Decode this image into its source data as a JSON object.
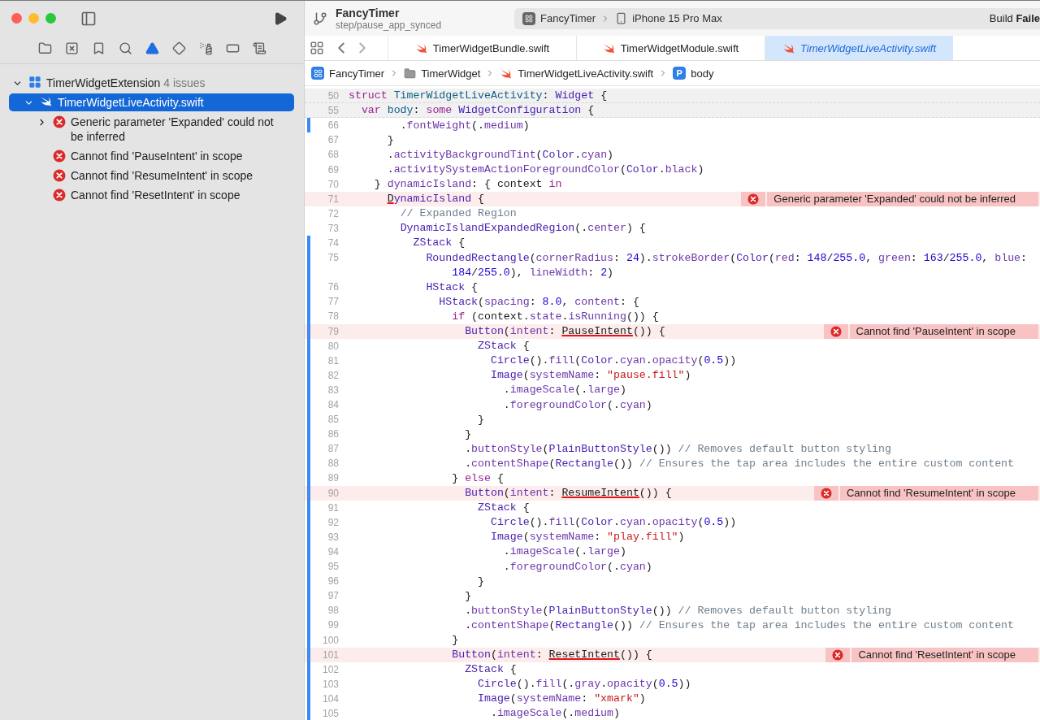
{
  "sidebar": {
    "navigator_tabs": [
      {
        "kind": "folder",
        "selected": false
      },
      {
        "kind": "source",
        "selected": false
      },
      {
        "kind": "bookmark",
        "selected": false
      },
      {
        "kind": "search",
        "selected": false
      },
      {
        "kind": "issue",
        "selected": true
      },
      {
        "kind": "test",
        "selected": false
      },
      {
        "kind": "debug",
        "selected": false
      },
      {
        "kind": "breakpoint",
        "selected": false
      },
      {
        "kind": "report",
        "selected": false
      }
    ],
    "group": {
      "name": "TimerWidgetExtension",
      "count": "4 issues",
      "expanded": true,
      "files": [
        {
          "name": "TimerWidgetLiveActivity.swift",
          "selected": true,
          "expanded": true,
          "issues": [
            {
              "message": "Generic parameter 'Expanded' could not be inferred",
              "expanded": false
            },
            {
              "message": "Cannot find 'PauseIntent' in scope"
            },
            {
              "message": "Cannot find 'ResumeIntent' in scope"
            },
            {
              "message": "Cannot find 'ResetIntent' in scope"
            }
          ]
        }
      ]
    }
  },
  "toolbar": {
    "project": "FancyTimer",
    "branch": "step/pause_app_synced",
    "scheme": "FancyTimer",
    "destination": "iPhone 15 Pro Max",
    "status": "Build **Faile**"
  },
  "tabs": [
    {
      "label": "TimerWidgetBundle.swift",
      "selected": false
    },
    {
      "label": "TimerWidgetModule.swift",
      "selected": false
    },
    {
      "label": "TimerWidgetLiveActivity.swift",
      "selected": true
    }
  ],
  "breadcrumb": [
    {
      "kind": "app",
      "label": "FancyTimer"
    },
    {
      "kind": "folder",
      "label": "TimerWidget"
    },
    {
      "kind": "swift",
      "label": "TimerWidgetLiveActivity.swift"
    },
    {
      "kind": "symbol",
      "badge": "P",
      "label": "body"
    }
  ],
  "code": {
    "lines": [
      {
        "number": "50",
        "sticky": true,
        "changed": false,
        "tokens": [
          {
            "kind": "kw",
            "text": "struct"
          },
          {
            "kind": "decl",
            "text": " TimerWidgetLiveActivity"
          },
          {
            "kind": "plain",
            "text": ": "
          },
          {
            "kind": "type",
            "text": "Widget"
          },
          {
            "kind": "plain",
            "text": " {"
          }
        ]
      },
      {
        "number": "55",
        "sticky": true,
        "changed": false,
        "tokens": [
          {
            "kind": "kw",
            "text": "  var"
          },
          {
            "kind": "decl",
            "text": " body"
          },
          {
            "kind": "plain",
            "text": ": "
          },
          {
            "kind": "kw",
            "text": "some"
          },
          {
            "kind": "type",
            "text": " WidgetConfiguration"
          },
          {
            "kind": "plain",
            "text": " {"
          }
        ]
      },
      {
        "number": "66",
        "sticky": false,
        "changed": true,
        "tokens": [
          {
            "kind": "plain",
            "text": "        ."
          },
          {
            "kind": "member",
            "text": "fontWeight"
          },
          {
            "kind": "plain",
            "text": "(."
          },
          {
            "kind": "member",
            "text": "medium"
          },
          {
            "kind": "plain",
            "text": ")"
          }
        ]
      },
      {
        "number": "67",
        "sticky": false,
        "changed": false,
        "tokens": [
          {
            "kind": "plain",
            "text": "      }"
          }
        ]
      },
      {
        "number": "68",
        "sticky": false,
        "changed": false,
        "tokens": [
          {
            "kind": "plain",
            "text": "      ."
          },
          {
            "kind": "member",
            "text": "activityBackgroundTint"
          },
          {
            "kind": "plain",
            "text": "("
          },
          {
            "kind": "type",
            "text": "Color"
          },
          {
            "kind": "plain",
            "text": "."
          },
          {
            "kind": "member",
            "text": "cyan"
          },
          {
            "kind": "plain",
            "text": ")"
          }
        ]
      },
      {
        "number": "69",
        "sticky": false,
        "changed": false,
        "tokens": [
          {
            "kind": "plain",
            "text": "      ."
          },
          {
            "kind": "member",
            "text": "activitySystemActionForegroundColor"
          },
          {
            "kind": "plain",
            "text": "("
          },
          {
            "kind": "type",
            "text": "Color"
          },
          {
            "kind": "plain",
            "text": "."
          },
          {
            "kind": "member",
            "text": "black"
          },
          {
            "kind": "plain",
            "text": ")"
          }
        ]
      },
      {
        "number": "70",
        "sticky": false,
        "changed": false,
        "tokens": [
          {
            "kind": "plain",
            "text": "    } "
          },
          {
            "kind": "member",
            "text": "dynamicIsland"
          },
          {
            "kind": "plain",
            "text": ": { context "
          },
          {
            "kind": "kw",
            "text": "in"
          }
        ]
      },
      {
        "number": "71",
        "sticky": false,
        "changed": false,
        "error": "Generic parameter 'Expanded' could not be inferred",
        "tokens": [
          {
            "kind": "err",
            "text": "      D"
          },
          {
            "kind": "type",
            "text": "ynamicIsland"
          },
          {
            "kind": "plain",
            "text": " {"
          }
        ]
      },
      {
        "number": "72",
        "sticky": false,
        "changed": false,
        "tokens": [
          {
            "kind": "cmt",
            "text": "        // Expanded Region"
          }
        ]
      },
      {
        "number": "73",
        "sticky": false,
        "changed": false,
        "tokens": [
          {
            "kind": "type",
            "text": "        DynamicIslandExpandedRegion"
          },
          {
            "kind": "plain",
            "text": "(."
          },
          {
            "kind": "member",
            "text": "center"
          },
          {
            "kind": "plain",
            "text": ") {"
          }
        ]
      },
      {
        "number": "74",
        "sticky": false,
        "changed": true,
        "tokens": [
          {
            "kind": "type",
            "text": "          ZStack"
          },
          {
            "kind": "plain",
            "text": " {"
          }
        ]
      },
      {
        "number": "75",
        "sticky": false,
        "changed": true,
        "tokens": [
          {
            "kind": "type",
            "text": "            RoundedRectangle"
          },
          {
            "kind": "plain",
            "text": "("
          },
          {
            "kind": "member",
            "text": "cornerRadius"
          },
          {
            "kind": "plain",
            "text": ": "
          },
          {
            "kind": "num",
            "text": "24"
          },
          {
            "kind": "plain",
            "text": ")."
          },
          {
            "kind": "member",
            "text": "strokeBorder"
          },
          {
            "kind": "plain",
            "text": "("
          },
          {
            "kind": "type",
            "text": "Color"
          },
          {
            "kind": "plain",
            "text": "("
          },
          {
            "kind": "member",
            "text": "red"
          },
          {
            "kind": "plain",
            "text": ": "
          },
          {
            "kind": "num",
            "text": "148"
          },
          {
            "kind": "plain",
            "text": "/"
          },
          {
            "kind": "num",
            "text": "255.0"
          },
          {
            "kind": "plain",
            "text": ", "
          },
          {
            "kind": "member",
            "text": "green"
          },
          {
            "kind": "plain",
            "text": ": "
          },
          {
            "kind": "num",
            "text": "163"
          },
          {
            "kind": "plain",
            "text": "/"
          },
          {
            "kind": "num",
            "text": "255.0"
          },
          {
            "kind": "plain",
            "text": ", "
          },
          {
            "kind": "member",
            "text": "blue"
          },
          {
            "kind": "plain",
            "text": ":"
          }
        ],
        "wrapped": [
          {
            "kind": "num",
            "text": "                184"
          },
          {
            "kind": "plain",
            "text": "/"
          },
          {
            "kind": "num",
            "text": "255.0"
          },
          {
            "kind": "plain",
            "text": "), "
          },
          {
            "kind": "member",
            "text": "lineWidth"
          },
          {
            "kind": "plain",
            "text": ": "
          },
          {
            "kind": "num",
            "text": "2"
          },
          {
            "kind": "plain",
            "text": ")"
          }
        ]
      },
      {
        "number": "76",
        "sticky": false,
        "changed": true,
        "tokens": [
          {
            "kind": "type",
            "text": "            HStack"
          },
          {
            "kind": "plain",
            "text": " {"
          }
        ]
      },
      {
        "number": "77",
        "sticky": false,
        "changed": true,
        "tokens": [
          {
            "kind": "type",
            "text": "              HStack"
          },
          {
            "kind": "plain",
            "text": "("
          },
          {
            "kind": "member",
            "text": "spacing"
          },
          {
            "kind": "plain",
            "text": ": "
          },
          {
            "kind": "num",
            "text": "8.0"
          },
          {
            "kind": "plain",
            "text": ", "
          },
          {
            "kind": "member",
            "text": "content"
          },
          {
            "kind": "plain",
            "text": ": {"
          }
        ]
      },
      {
        "number": "78",
        "sticky": false,
        "changed": true,
        "tokens": [
          {
            "kind": "kw",
            "text": "                if"
          },
          {
            "kind": "plain",
            "text": " (context."
          },
          {
            "kind": "member",
            "text": "state"
          },
          {
            "kind": "plain",
            "text": "."
          },
          {
            "kind": "member",
            "text": "isRunning"
          },
          {
            "kind": "plain",
            "text": "()) {"
          }
        ]
      },
      {
        "number": "79",
        "sticky": false,
        "changed": true,
        "error": "Cannot find 'PauseIntent' in scope",
        "tokens": [
          {
            "kind": "type",
            "text": "                  Button"
          },
          {
            "kind": "plain",
            "text": "("
          },
          {
            "kind": "member",
            "text": "intent"
          },
          {
            "kind": "plain",
            "text": ": "
          },
          {
            "kind": "err",
            "text": "PauseIntent"
          },
          {
            "kind": "plain",
            "text": "()) {"
          }
        ]
      },
      {
        "number": "80",
        "sticky": false,
        "changed": true,
        "tokens": [
          {
            "kind": "type",
            "text": "                    ZStack"
          },
          {
            "kind": "plain",
            "text": " {"
          }
        ]
      },
      {
        "number": "81",
        "sticky": false,
        "changed": true,
        "tokens": [
          {
            "kind": "type",
            "text": "                      Circle"
          },
          {
            "kind": "plain",
            "text": "()."
          },
          {
            "kind": "member",
            "text": "fill"
          },
          {
            "kind": "plain",
            "text": "("
          },
          {
            "kind": "type",
            "text": "Color"
          },
          {
            "kind": "plain",
            "text": "."
          },
          {
            "kind": "member",
            "text": "cyan"
          },
          {
            "kind": "plain",
            "text": "."
          },
          {
            "kind": "member",
            "text": "opacity"
          },
          {
            "kind": "plain",
            "text": "("
          },
          {
            "kind": "num",
            "text": "0.5"
          },
          {
            "kind": "plain",
            "text": "))"
          }
        ]
      },
      {
        "number": "82",
        "sticky": false,
        "changed": true,
        "tokens": [
          {
            "kind": "type",
            "text": "                      Image"
          },
          {
            "kind": "plain",
            "text": "("
          },
          {
            "kind": "member",
            "text": "systemName"
          },
          {
            "kind": "plain",
            "text": ": "
          },
          {
            "kind": "str",
            "text": "\"pause.fill\""
          },
          {
            "kind": "plain",
            "text": ")"
          }
        ]
      },
      {
        "number": "83",
        "sticky": false,
        "changed": true,
        "tokens": [
          {
            "kind": "plain",
            "text": "                        ."
          },
          {
            "kind": "member",
            "text": "imageScale"
          },
          {
            "kind": "plain",
            "text": "(."
          },
          {
            "kind": "member",
            "text": "large"
          },
          {
            "kind": "plain",
            "text": ")"
          }
        ]
      },
      {
        "number": "84",
        "sticky": false,
        "changed": true,
        "tokens": [
          {
            "kind": "plain",
            "text": "                        ."
          },
          {
            "kind": "member",
            "text": "foregroundColor"
          },
          {
            "kind": "plain",
            "text": "(."
          },
          {
            "kind": "member",
            "text": "cyan"
          },
          {
            "kind": "plain",
            "text": ")"
          }
        ]
      },
      {
        "number": "85",
        "sticky": false,
        "changed": true,
        "tokens": [
          {
            "kind": "plain",
            "text": "                    }"
          }
        ]
      },
      {
        "number": "86",
        "sticky": false,
        "changed": true,
        "tokens": [
          {
            "kind": "plain",
            "text": "                  }"
          }
        ]
      },
      {
        "number": "87",
        "sticky": false,
        "changed": true,
        "tokens": [
          {
            "kind": "plain",
            "text": "                  ."
          },
          {
            "kind": "member",
            "text": "buttonStyle"
          },
          {
            "kind": "plain",
            "text": "("
          },
          {
            "kind": "type",
            "text": "PlainButtonStyle"
          },
          {
            "kind": "plain",
            "text": "()) "
          },
          {
            "kind": "cmt",
            "text": "// Removes default button styling"
          }
        ]
      },
      {
        "number": "88",
        "sticky": false,
        "changed": true,
        "tokens": [
          {
            "kind": "plain",
            "text": "                  ."
          },
          {
            "kind": "member",
            "text": "contentShape"
          },
          {
            "kind": "plain",
            "text": "("
          },
          {
            "kind": "type",
            "text": "Rectangle"
          },
          {
            "kind": "plain",
            "text": "()) "
          },
          {
            "kind": "cmt",
            "text": "// Ensures the tap area includes the entire custom content"
          }
        ]
      },
      {
        "number": "89",
        "sticky": false,
        "changed": true,
        "tokens": [
          {
            "kind": "plain",
            "text": "                } "
          },
          {
            "kind": "kw",
            "text": "else"
          },
          {
            "kind": "plain",
            "text": " {"
          }
        ]
      },
      {
        "number": "90",
        "sticky": false,
        "changed": true,
        "error": "Cannot find 'ResumeIntent' in scope",
        "tokens": [
          {
            "kind": "type",
            "text": "                  Button"
          },
          {
            "kind": "plain",
            "text": "("
          },
          {
            "kind": "member",
            "text": "intent"
          },
          {
            "kind": "plain",
            "text": ": "
          },
          {
            "kind": "err",
            "text": "ResumeIntent"
          },
          {
            "kind": "plain",
            "text": "()) {"
          }
        ]
      },
      {
        "number": "91",
        "sticky": false,
        "changed": true,
        "tokens": [
          {
            "kind": "type",
            "text": "                    ZStack"
          },
          {
            "kind": "plain",
            "text": " {"
          }
        ]
      },
      {
        "number": "92",
        "sticky": false,
        "changed": true,
        "tokens": [
          {
            "kind": "type",
            "text": "                      Circle"
          },
          {
            "kind": "plain",
            "text": "()."
          },
          {
            "kind": "member",
            "text": "fill"
          },
          {
            "kind": "plain",
            "text": "("
          },
          {
            "kind": "type",
            "text": "Color"
          },
          {
            "kind": "plain",
            "text": "."
          },
          {
            "kind": "member",
            "text": "cyan"
          },
          {
            "kind": "plain",
            "text": "."
          },
          {
            "kind": "member",
            "text": "opacity"
          },
          {
            "kind": "plain",
            "text": "("
          },
          {
            "kind": "num",
            "text": "0.5"
          },
          {
            "kind": "plain",
            "text": "))"
          }
        ]
      },
      {
        "number": "93",
        "sticky": false,
        "changed": true,
        "tokens": [
          {
            "kind": "type",
            "text": "                      Image"
          },
          {
            "kind": "plain",
            "text": "("
          },
          {
            "kind": "member",
            "text": "systemName"
          },
          {
            "kind": "plain",
            "text": ": "
          },
          {
            "kind": "str",
            "text": "\"play.fill\""
          },
          {
            "kind": "plain",
            "text": ")"
          }
        ]
      },
      {
        "number": "94",
        "sticky": false,
        "changed": true,
        "tokens": [
          {
            "kind": "plain",
            "text": "                        ."
          },
          {
            "kind": "member",
            "text": "imageScale"
          },
          {
            "kind": "plain",
            "text": "(."
          },
          {
            "kind": "member",
            "text": "large"
          },
          {
            "kind": "plain",
            "text": ")"
          }
        ]
      },
      {
        "number": "95",
        "sticky": false,
        "changed": true,
        "tokens": [
          {
            "kind": "plain",
            "text": "                        ."
          },
          {
            "kind": "member",
            "text": "foregroundColor"
          },
          {
            "kind": "plain",
            "text": "(."
          },
          {
            "kind": "member",
            "text": "cyan"
          },
          {
            "kind": "plain",
            "text": ")"
          }
        ]
      },
      {
        "number": "96",
        "sticky": false,
        "changed": true,
        "tokens": [
          {
            "kind": "plain",
            "text": "                    }"
          }
        ]
      },
      {
        "number": "97",
        "sticky": false,
        "changed": true,
        "tokens": [
          {
            "kind": "plain",
            "text": "                  }"
          }
        ]
      },
      {
        "number": "98",
        "sticky": false,
        "changed": true,
        "tokens": [
          {
            "kind": "plain",
            "text": "                  ."
          },
          {
            "kind": "member",
            "text": "buttonStyle"
          },
          {
            "kind": "plain",
            "text": "("
          },
          {
            "kind": "type",
            "text": "PlainButtonStyle"
          },
          {
            "kind": "plain",
            "text": "()) "
          },
          {
            "kind": "cmt",
            "text": "// Removes default button styling"
          }
        ]
      },
      {
        "number": "99",
        "sticky": false,
        "changed": true,
        "tokens": [
          {
            "kind": "plain",
            "text": "                  ."
          },
          {
            "kind": "member",
            "text": "contentShape"
          },
          {
            "kind": "plain",
            "text": "("
          },
          {
            "kind": "type",
            "text": "Rectangle"
          },
          {
            "kind": "plain",
            "text": "()) "
          },
          {
            "kind": "cmt",
            "text": "// Ensures the tap area includes the entire custom content"
          }
        ]
      },
      {
        "number": "100",
        "sticky": false,
        "changed": true,
        "tokens": [
          {
            "kind": "plain",
            "text": "                }"
          }
        ]
      },
      {
        "number": "101",
        "sticky": false,
        "changed": true,
        "error": "Cannot find 'ResetIntent' in scope",
        "tokens": [
          {
            "kind": "type",
            "text": "                Button"
          },
          {
            "kind": "plain",
            "text": "("
          },
          {
            "kind": "member",
            "text": "intent"
          },
          {
            "kind": "plain",
            "text": ": "
          },
          {
            "kind": "err",
            "text": "ResetIntent"
          },
          {
            "kind": "plain",
            "text": "()) {"
          }
        ]
      },
      {
        "number": "102",
        "sticky": false,
        "changed": true,
        "tokens": [
          {
            "kind": "type",
            "text": "                  ZStack"
          },
          {
            "kind": "plain",
            "text": " {"
          }
        ]
      },
      {
        "number": "103",
        "sticky": false,
        "changed": true,
        "tokens": [
          {
            "kind": "type",
            "text": "                    Circle"
          },
          {
            "kind": "plain",
            "text": "()."
          },
          {
            "kind": "member",
            "text": "fill"
          },
          {
            "kind": "plain",
            "text": "(."
          },
          {
            "kind": "member",
            "text": "gray"
          },
          {
            "kind": "plain",
            "text": "."
          },
          {
            "kind": "member",
            "text": "opacity"
          },
          {
            "kind": "plain",
            "text": "("
          },
          {
            "kind": "num",
            "text": "0.5"
          },
          {
            "kind": "plain",
            "text": "))"
          }
        ]
      },
      {
        "number": "104",
        "sticky": false,
        "changed": true,
        "tokens": [
          {
            "kind": "type",
            "text": "                    Image"
          },
          {
            "kind": "plain",
            "text": "("
          },
          {
            "kind": "member",
            "text": "systemName"
          },
          {
            "kind": "plain",
            "text": ": "
          },
          {
            "kind": "str",
            "text": "\"xmark\""
          },
          {
            "kind": "plain",
            "text": ")"
          }
        ]
      },
      {
        "number": "105",
        "sticky": false,
        "changed": true,
        "tokens": [
          {
            "kind": "plain",
            "text": "                      ."
          },
          {
            "kind": "member",
            "text": "imageScale"
          },
          {
            "kind": "plain",
            "text": "(."
          },
          {
            "kind": "member",
            "text": "medium"
          },
          {
            "kind": "plain",
            "text": ")"
          }
        ]
      }
    ]
  }
}
